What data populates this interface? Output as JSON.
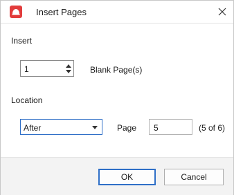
{
  "window": {
    "title": "Insert Pages"
  },
  "insert": {
    "section_label": "Insert",
    "count_value": "1",
    "unit_label": "Blank Page(s)"
  },
  "location": {
    "section_label": "Location",
    "position_value": "After",
    "page_label": "Page",
    "page_value": "5",
    "page_info": "(5 of 6)"
  },
  "buttons": {
    "ok": "OK",
    "cancel": "Cancel"
  },
  "colors": {
    "app_icon": "#e23c3c",
    "focus_accent": "#2f6fc7"
  },
  "icons": {
    "app": "app-logo-icon",
    "close": "close-icon"
  }
}
